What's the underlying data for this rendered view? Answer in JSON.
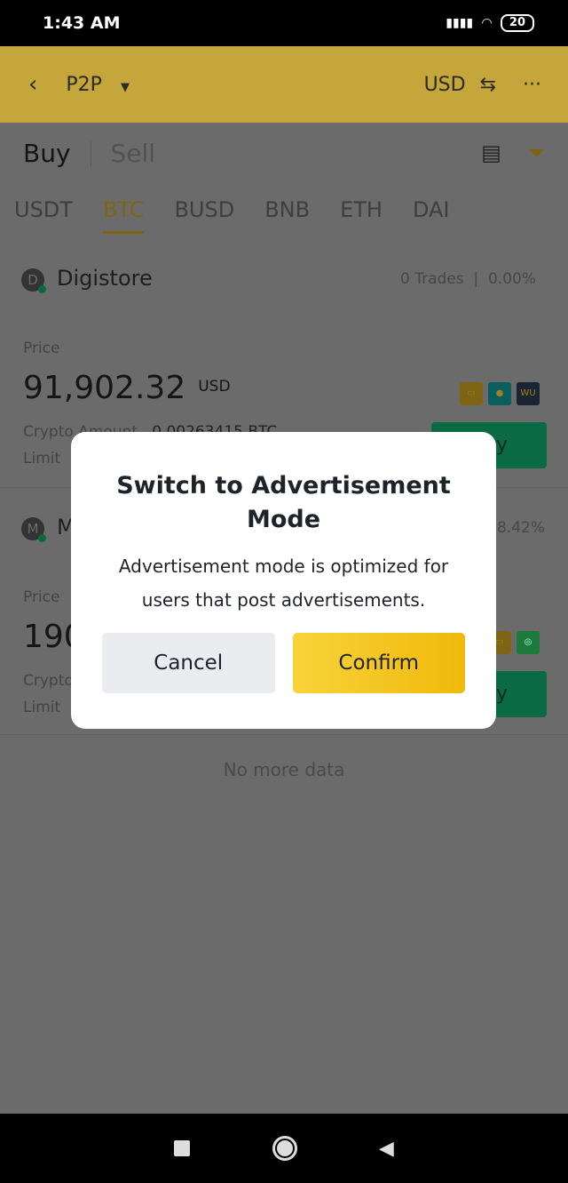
{
  "status_bar": {
    "time": "1:43 AM",
    "battery": "20"
  },
  "header": {
    "title": "P2P",
    "currency": "USD"
  },
  "tabs": {
    "buy": "Buy",
    "sell": "Sell"
  },
  "coins": [
    "USDT",
    "BTC",
    "BUSD",
    "BNB",
    "ETH",
    "DAI"
  ],
  "active_coin": "BTC",
  "ads": [
    {
      "initial": "D",
      "name": "Digistore",
      "trades": "0 Trades",
      "completion": "0.00%",
      "price_label": "Price",
      "price": "91,902.32",
      "currency": "USD",
      "amount_label": "Crypto Amount",
      "amount": "0.00263415 BTC",
      "limit_label": "Limit",
      "button": "Buy"
    },
    {
      "initial": "M",
      "name": "M",
      "completion": "8.42%",
      "price_label": "Price",
      "price": "190",
      "amount_label": "Crypto",
      "limit_label": "Limit",
      "button": "Buy"
    }
  ],
  "no_more": "No more data",
  "dialog": {
    "title": "Switch to Advertisement Mode",
    "message": "Advertisement mode is optimized for users that post advertisements.",
    "cancel": "Cancel",
    "confirm": "Confirm"
  },
  "colors": {
    "accent": "#F0B90B",
    "buy": "#0ECB81"
  }
}
